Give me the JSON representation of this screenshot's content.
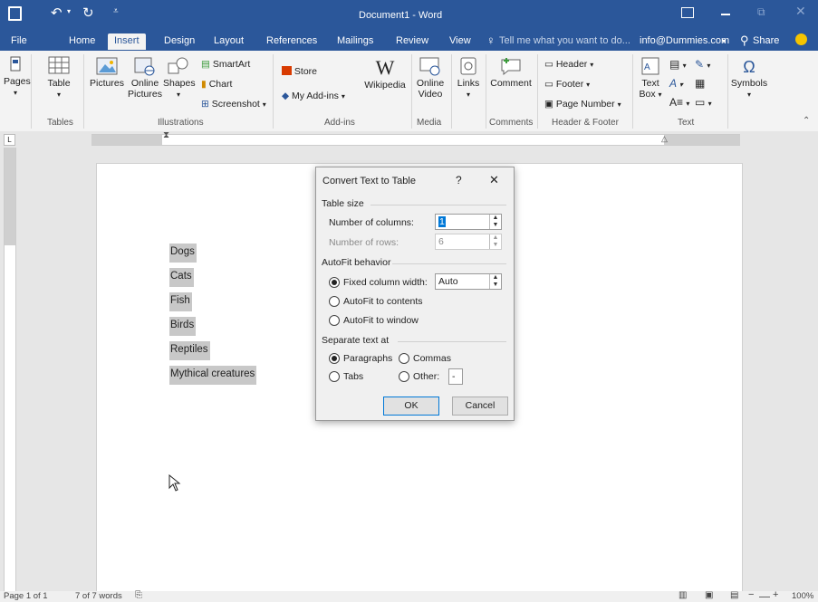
{
  "window": {
    "title": "Document1 - Word"
  },
  "tabs": [
    "File",
    "Home",
    "Insert",
    "Design",
    "Layout",
    "References",
    "Mailings",
    "Review",
    "View"
  ],
  "active_tab": "Insert",
  "tell_me": "Tell me what you want to do...",
  "account": "info@Dummies.com",
  "share": "Share",
  "ribbon": {
    "pages": "Pages",
    "table": "Table",
    "pictures": "Pictures",
    "online_pictures_1": "Online",
    "online_pictures_2": "Pictures",
    "shapes": "Shapes",
    "smartart": "SmartArt",
    "chart": "Chart",
    "screenshot": "Screenshot",
    "store": "Store",
    "my_addins": "My Add-ins",
    "wikipedia": "Wikipedia",
    "online_video_1": "Online",
    "online_video_2": "Video",
    "links": "Links",
    "comment": "Comment",
    "header": "Header",
    "footer": "Footer",
    "page_number": "Page Number",
    "text_box_1": "Text",
    "text_box_2": "Box",
    "symbols": "Symbols",
    "groups": {
      "tables": "Tables",
      "illustrations": "Illustrations",
      "addins": "Add-ins",
      "media": "Media",
      "comments": "Comments",
      "header_footer": "Header & Footer",
      "text": "Text"
    }
  },
  "document": {
    "lines": [
      "Dogs",
      "Cats",
      "Fish",
      "Birds",
      "Reptiles",
      "Mythical creatures"
    ]
  },
  "dialog": {
    "title": "Convert Text to Table",
    "help": "?",
    "close": "✕",
    "table_size": "Table size",
    "num_columns_label": "Number of columns:",
    "num_columns_value": "1",
    "num_rows_label": "Number of rows:",
    "num_rows_value": "6",
    "autofit_behavior": "AutoFit behavior",
    "fixed_width_label": "Fixed column width:",
    "fixed_width_value": "Auto",
    "autofit_contents": "AutoFit to contents",
    "autofit_window": "AutoFit to window",
    "separate_text_at": "Separate text at",
    "paragraphs": "Paragraphs",
    "commas": "Commas",
    "tabs": "Tabs",
    "other": "Other:",
    "other_value": "-",
    "ok": "OK",
    "cancel": "Cancel"
  },
  "status": {
    "page": "Page 1 of 1",
    "words": "7 of 7 words",
    "zoom": "100%"
  },
  "colors": {
    "accent": "#2b579a",
    "selection": "#c8c8c8"
  }
}
